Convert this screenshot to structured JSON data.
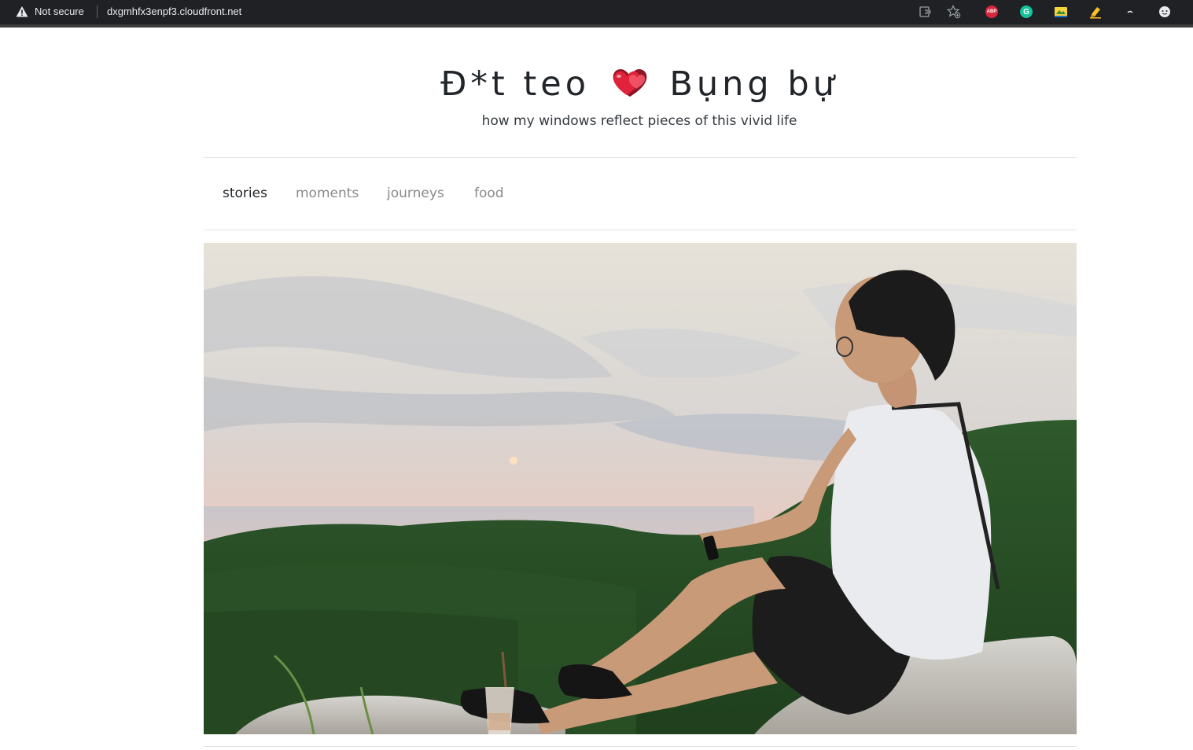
{
  "browser": {
    "security_label": "Not secure",
    "url": "dxgmhfx3enpf3.cloudfront.net",
    "toolbar_icons": [
      "read-aloud-icon",
      "favorites-icon",
      "adblock-plus-icon",
      "grammarly-icon",
      "screenshot-extension-icon",
      "highlighter-extension-icon",
      "extension-icon",
      "profile-icon"
    ],
    "abp_label": "ABP",
    "grammarly_label": "G"
  },
  "header": {
    "title_left": "Đ*t teo",
    "title_right": "Bụng bự",
    "heart_icon": "two-hearts-icon",
    "tagline": "how my windows reflect pieces of this vivid life"
  },
  "nav": {
    "items": [
      {
        "label": "stories",
        "active": true
      },
      {
        "label": "moments",
        "active": false
      },
      {
        "label": "journeys",
        "active": false
      },
      {
        "label": "food",
        "active": false
      }
    ]
  },
  "colors": {
    "topbar": "#202124",
    "text": "#212529",
    "nav_inactive": "#8a8a8a",
    "divider": "#dee2e6",
    "heart": "#e0233a"
  }
}
